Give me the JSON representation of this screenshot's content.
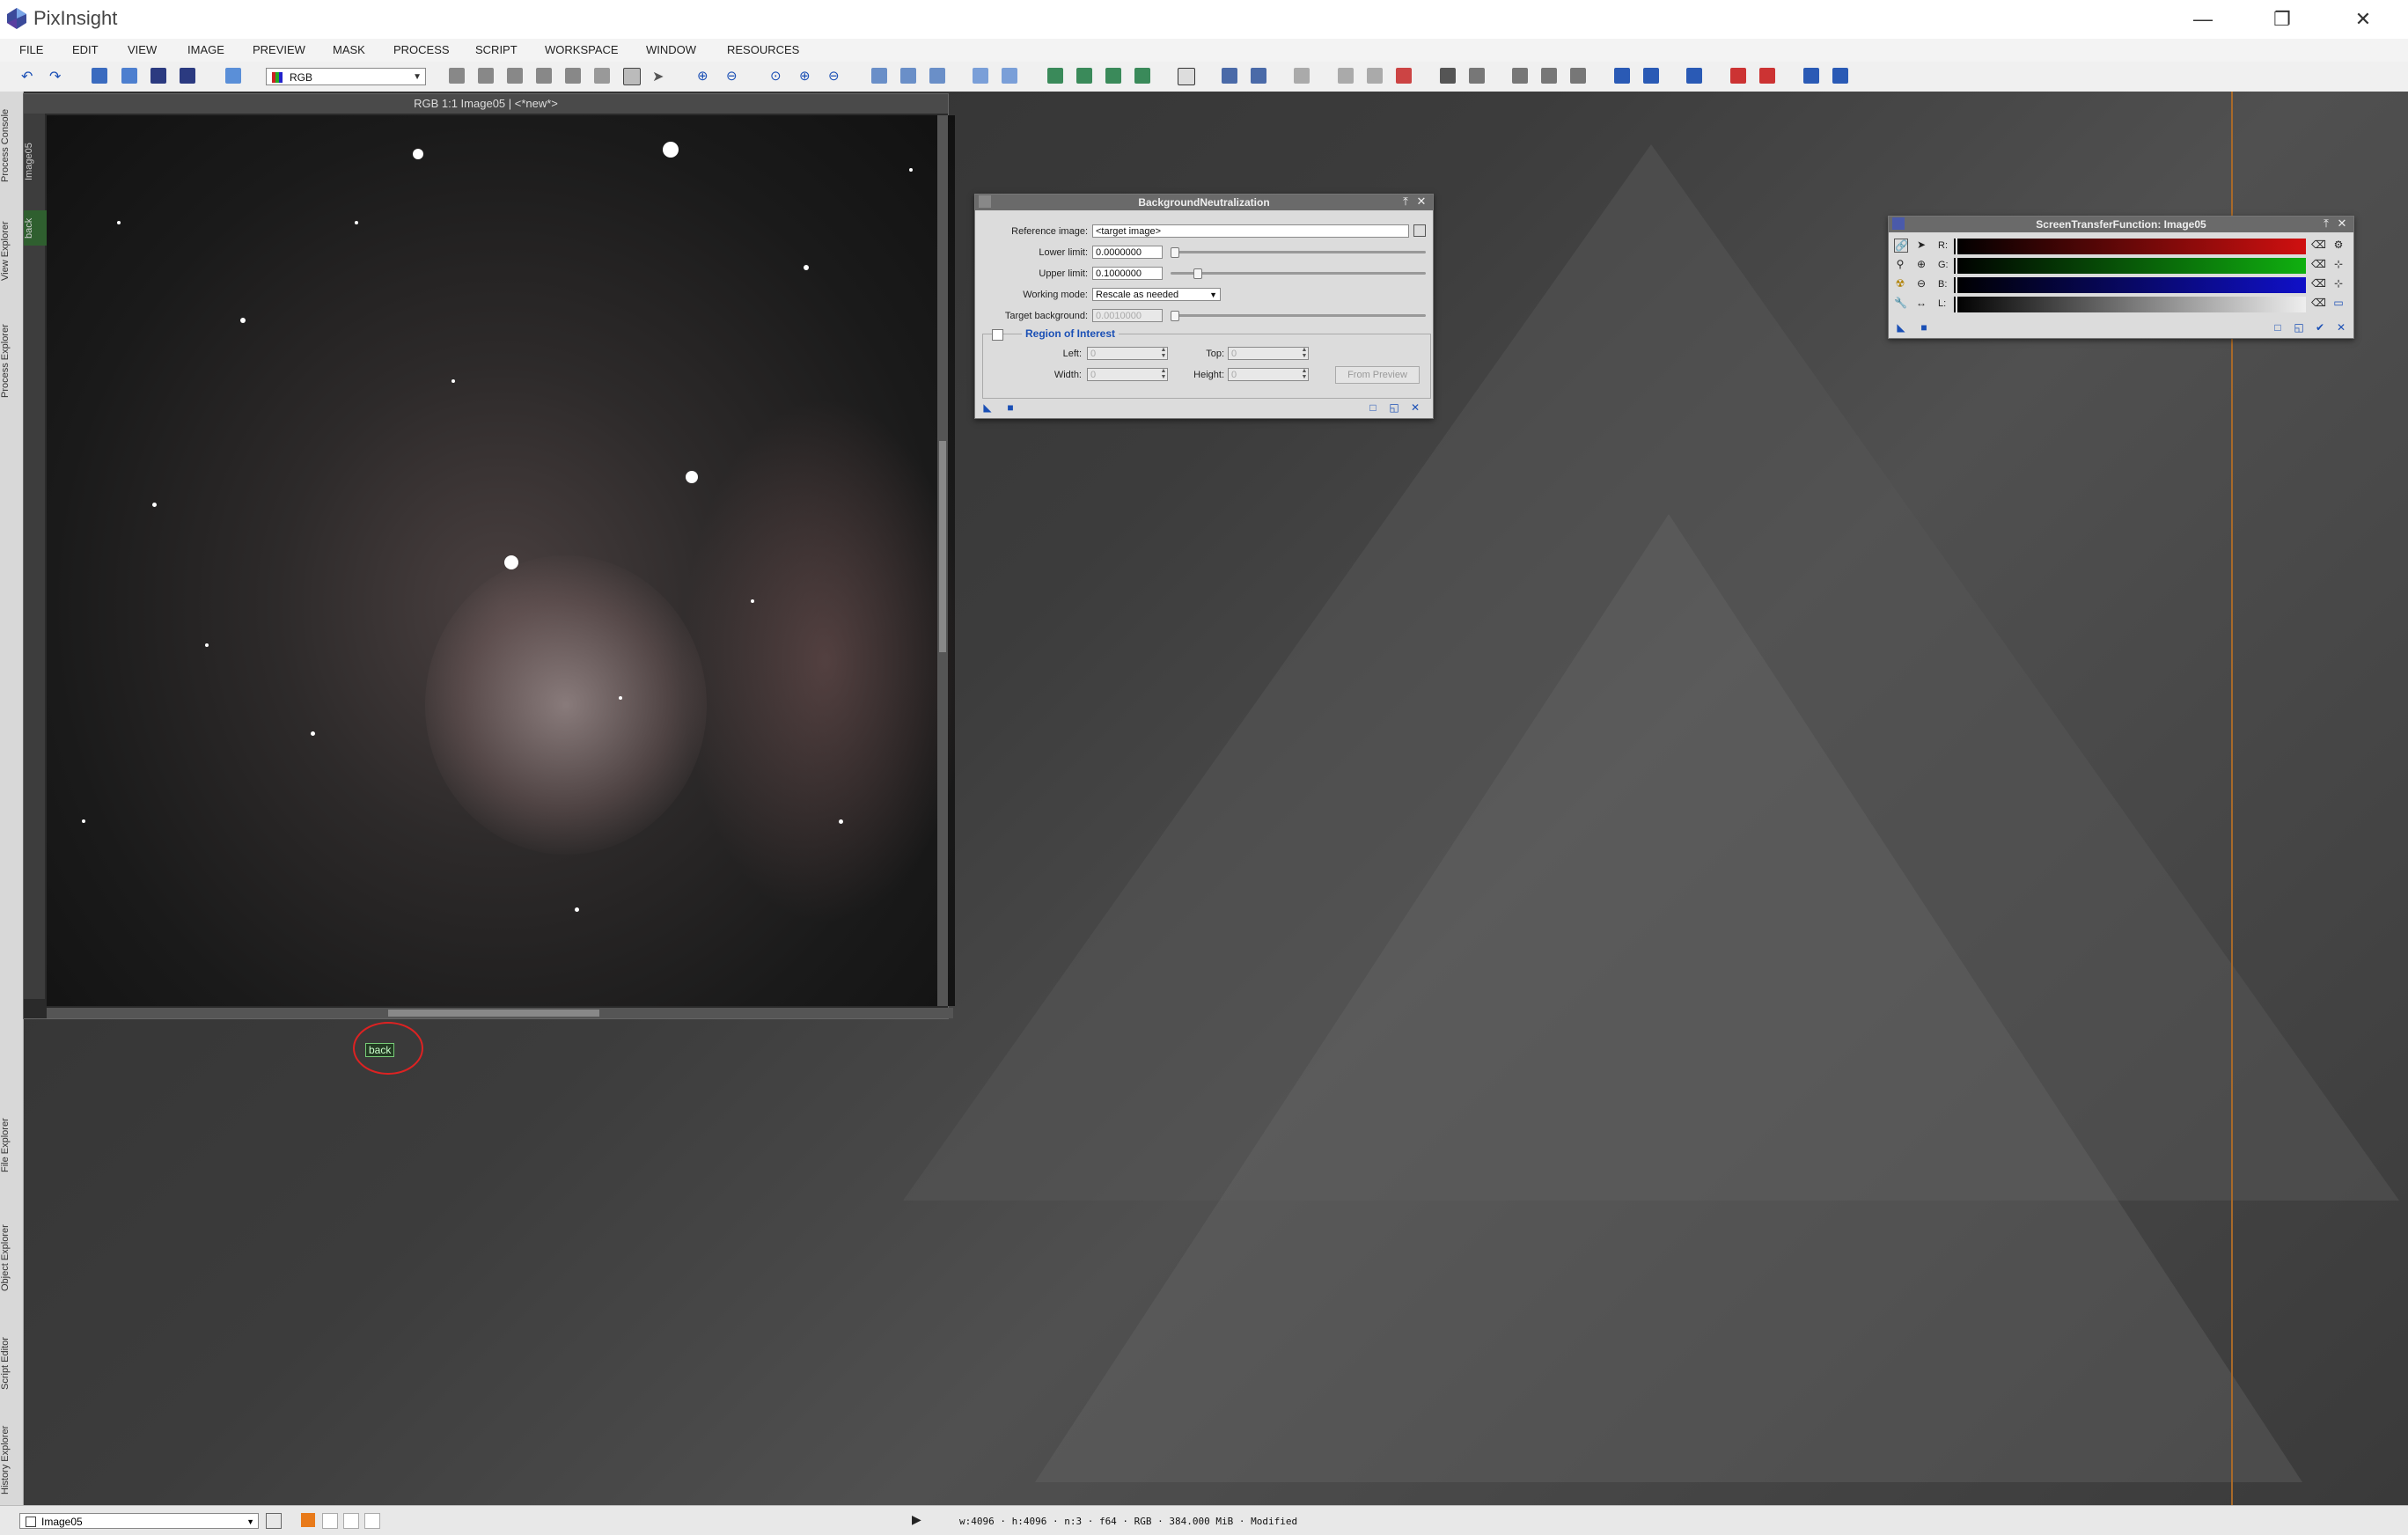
{
  "app": {
    "title": "PixInsight"
  },
  "window_controls": {
    "minimize": "—",
    "restore": "❐",
    "close": "✕"
  },
  "menu": [
    "FILE",
    "EDIT",
    "VIEW",
    "IMAGE",
    "PREVIEW",
    "MASK",
    "PROCESS",
    "SCRIPT",
    "WORKSPACE",
    "WINDOW",
    "RESOURCES"
  ],
  "toolbar": {
    "color_mode": "RGB"
  },
  "left_dock": {
    "top_tabs": [
      "Process Console",
      "View Explorer",
      "Process Explorer"
    ],
    "bottom_tabs": [
      "File Explorer",
      "Object Explorer",
      "Script Editor",
      "History Explorer"
    ]
  },
  "image_window": {
    "title": "RGB 1:1 Image05 | <*new*>",
    "side_tabs": [
      "Image05",
      "back"
    ],
    "preview_label": "back"
  },
  "background_neutralization": {
    "title": "BackgroundNeutralization",
    "reference_image_label": "Reference image:",
    "reference_image_value": "<target image>",
    "lower_limit_label": "Lower limit:",
    "lower_limit_value": "0.0000000",
    "upper_limit_label": "Upper limit:",
    "upper_limit_value": "0.1000000",
    "working_mode_label": "Working mode:",
    "working_mode_value": "Rescale as needed",
    "target_background_label": "Target background:",
    "target_background_value": "0.0010000",
    "roi_title": "Region of Interest",
    "left_label": "Left:",
    "left_value": "0",
    "top_label": "Top:",
    "top_value": "0",
    "width_label": "Width:",
    "width_value": "0",
    "height_label": "Height:",
    "height_value": "0",
    "from_preview_label": "From Preview"
  },
  "stf": {
    "title": "ScreenTransferFunction: Image05",
    "channels": [
      {
        "label": "R:",
        "color": "#d01010"
      },
      {
        "label": "G:",
        "color": "#10b010"
      },
      {
        "label": "B:",
        "color": "#1010c8"
      },
      {
        "label": "L:",
        "color": "#aaaaaa"
      }
    ]
  },
  "statusbar": {
    "view": "Image05",
    "info": "w:4096 · h:4096 · n:3 · f64 · RGB · 384.000 MiB · Modified"
  }
}
